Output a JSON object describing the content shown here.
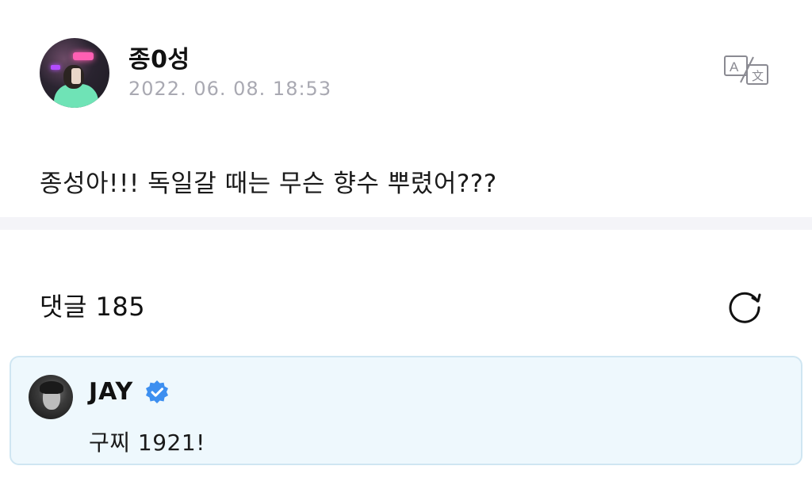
{
  "post": {
    "author_name": "종0성",
    "timestamp": "2022. 06. 08. 18:53",
    "text": "종성아!!! 독일갈 때는 무슨 향수 뿌렸어???"
  },
  "comments": {
    "title": "댓글 185",
    "items": [
      {
        "author": "JAY",
        "verified": true,
        "text": "구찌 1921!"
      }
    ]
  },
  "icons": {
    "translate": "translate-icon",
    "refresh": "refresh-icon",
    "verified": "verified-badge-icon"
  },
  "colors": {
    "verified_blue": "#3d8ff0",
    "timestamp_gray": "#a9a9b2",
    "comment_bg": "#eef8fd",
    "comment_border": "#cfe6f2",
    "separator": "#f4f4f8"
  }
}
